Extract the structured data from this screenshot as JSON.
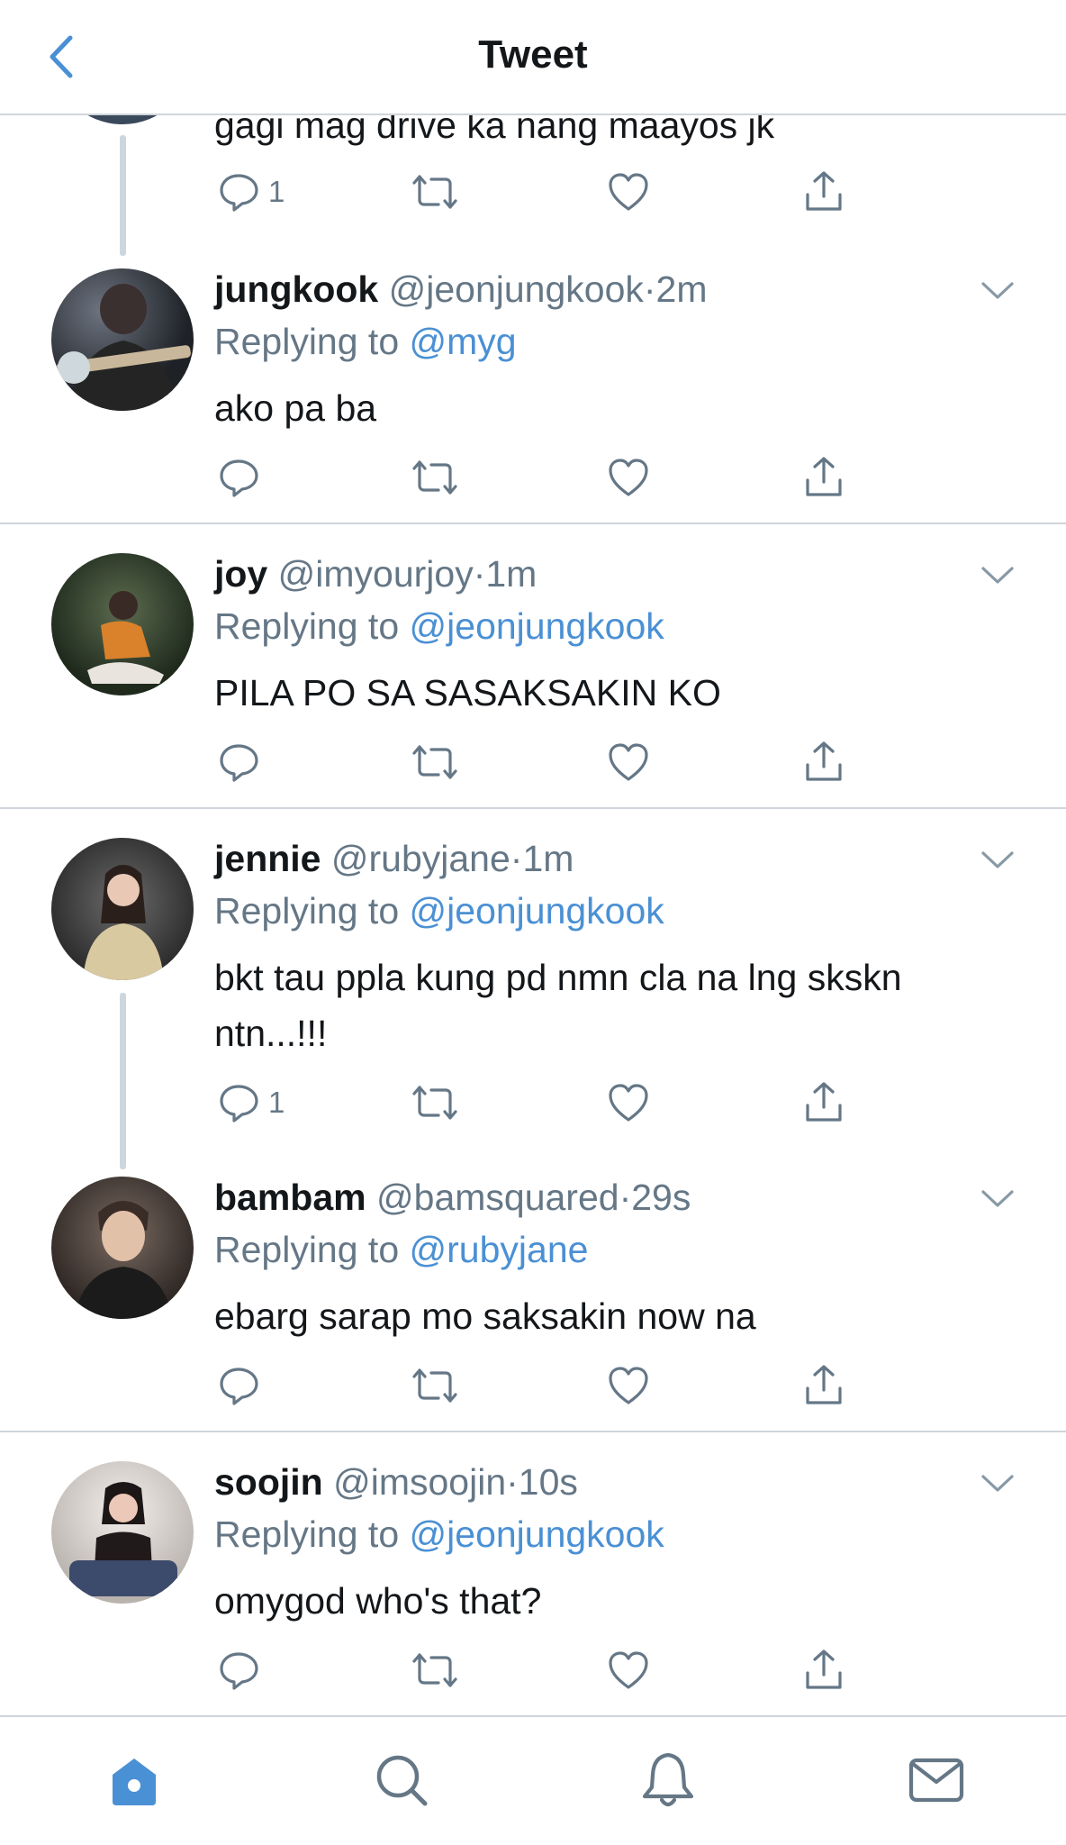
{
  "header": {
    "title": "Tweet"
  },
  "top_tweet": {
    "text": "gagi mag drive ka nang maayos jk",
    "reply_count": "1"
  },
  "tweets": [
    {
      "name": "jungkook",
      "handle": "@jeonjungkook",
      "dot": "·",
      "time": "2m",
      "replying_label": "Replying to",
      "replying_to": "@myg",
      "text": "ako pa ba",
      "reply_count": ""
    },
    {
      "name": "joy",
      "handle": "@imyourjoy",
      "dot": "·",
      "time": "1m",
      "replying_label": "Replying to",
      "replying_to": "@jeonjungkook",
      "text": "PILA PO SA SASAKSAKIN KO",
      "reply_count": ""
    },
    {
      "name": "jennie",
      "handle": "@rubyjane",
      "dot": "·",
      "time": "1m",
      "replying_label": "Replying to",
      "replying_to": "@jeonjungkook",
      "text": "bkt tau ppla kung pd nmn cla na lng skskn ntn...!!!",
      "reply_count": "1"
    },
    {
      "name": "bambam",
      "handle": "@bamsquared",
      "dot": "·",
      "time": "29s",
      "replying_label": "Replying to",
      "replying_to": "@rubyjane",
      "text": "ebarg sarap mo saksakin now na",
      "reply_count": ""
    },
    {
      "name": "soojin",
      "handle": "@imsoojin",
      "dot": "·",
      "time": "10s",
      "replying_label": "Replying to",
      "replying_to": "@jeonjungkook",
      "text": "omygod who's that?",
      "reply_count": ""
    }
  ],
  "tabs": [
    "home-icon",
    "search-icon",
    "notifications-icon",
    "messages-icon"
  ],
  "colors": {
    "accent": "#4a90d4",
    "muted": "#657786",
    "divider": "#cfd5da",
    "text": "#14171a"
  }
}
